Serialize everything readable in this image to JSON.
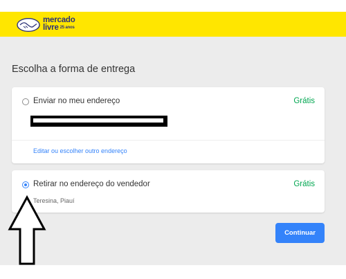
{
  "header": {
    "logo_line1": "mercado",
    "logo_line2": "livre",
    "logo_badge": "25 anos",
    "color": "#ffe600"
  },
  "page": {
    "title": "Escolha a forma de entrega"
  },
  "options": [
    {
      "label": "Enviar no meu endereço",
      "price": "Grátis",
      "selected": false,
      "address": "[redacted]",
      "link": "Editar ou escolher outro endereço"
    },
    {
      "label": "Retirar no endereço do vendedor",
      "price": "Grátis",
      "selected": true,
      "location": "Teresina, Piauí"
    }
  ],
  "continue_button": {
    "label": "Continuar",
    "color": "#3483fa"
  },
  "annotation": {
    "icon": "up-arrow-icon"
  },
  "colors": {
    "accent": "#3483fa",
    "free": "#00a650"
  }
}
